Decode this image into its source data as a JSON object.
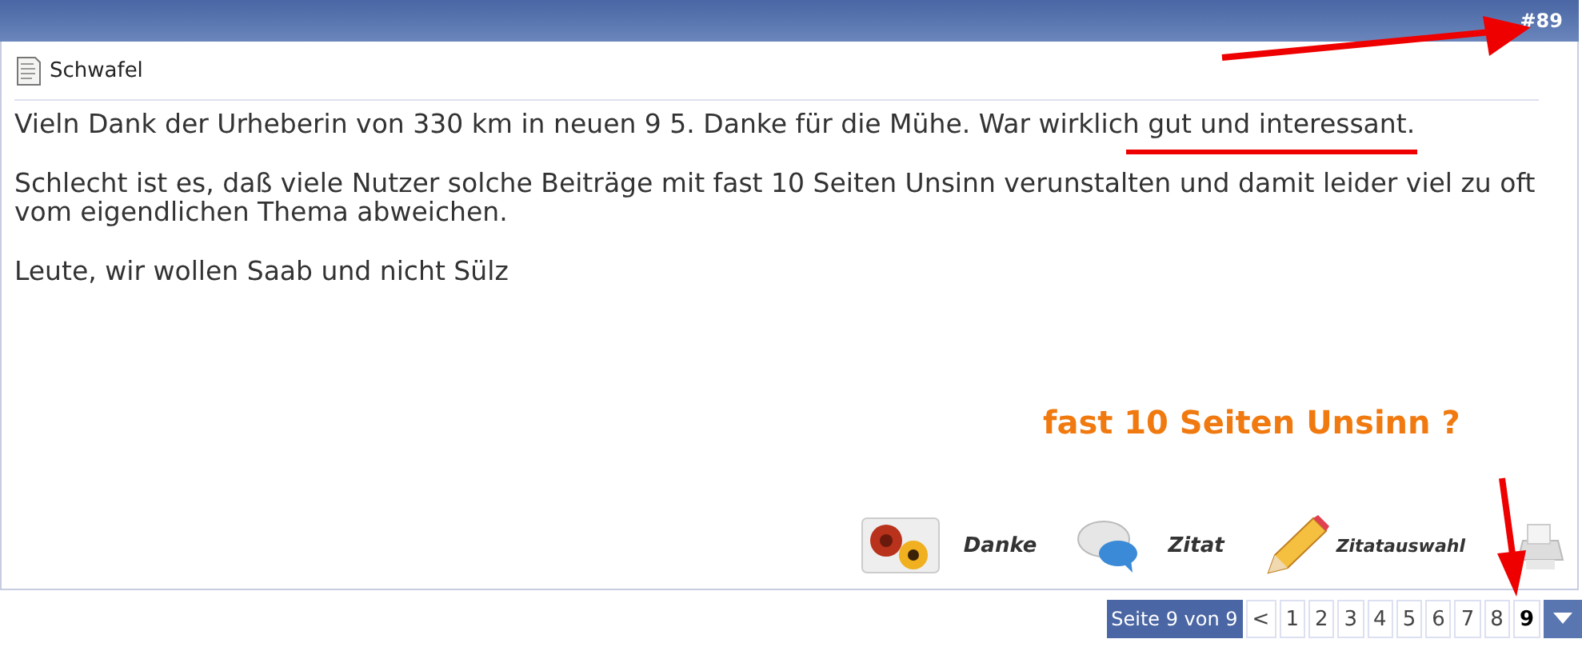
{
  "post": {
    "number": "#89",
    "author": "Schwafel",
    "paragraphs": [
      "Vieln Dank der Urheberin von 330 km in neuen 9 5. Danke für die Mühe. War wirklich gut und interessant.",
      "Schlecht ist es, daß viele Nutzer solche Beiträge mit fast 10 Seiten Unsinn verunstalten und damit leider viel zu oft vom eigendlichen Thema abweichen.",
      "Leute, wir wollen Saab und nicht Sülz"
    ],
    "actions": [
      {
        "kind": "thanks",
        "label": "Danke"
      },
      {
        "kind": "quote",
        "label": "Zitat"
      },
      {
        "kind": "select",
        "label": "Zitatauswahl"
      },
      {
        "kind": "print"
      }
    ]
  },
  "annotation": {
    "text": "fast 10 Seiten Unsinn ?"
  },
  "pagination": {
    "label": "Seite 9 von 9",
    "prev": "<",
    "pages": [
      {
        "label": "1",
        "selected": false
      },
      {
        "label": "2",
        "selected": false
      },
      {
        "label": "3",
        "selected": false
      },
      {
        "label": "4",
        "selected": false
      },
      {
        "label": "5",
        "selected": false
      },
      {
        "label": "6",
        "selected": false
      },
      {
        "label": "7",
        "selected": false
      },
      {
        "label": "8",
        "selected": false
      },
      {
        "label": "9",
        "selected": true
      }
    ]
  }
}
